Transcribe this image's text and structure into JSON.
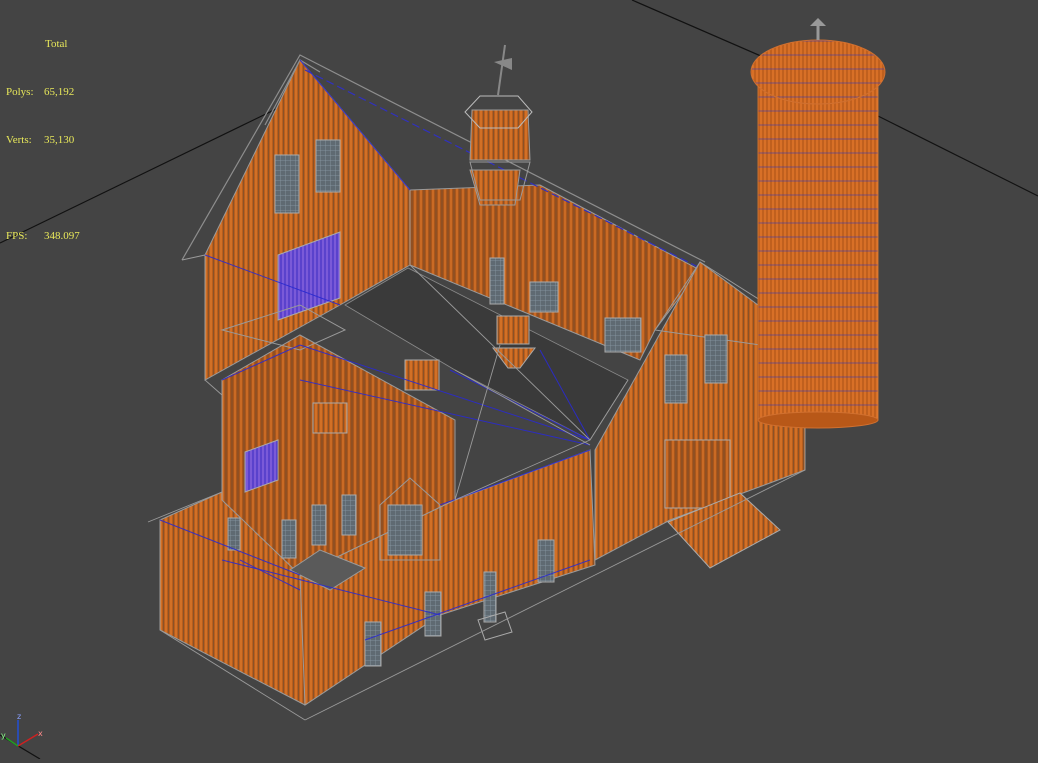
{
  "stats": {
    "title": "Total",
    "polys_label": "Polys:",
    "polys_value": "65,192",
    "verts_label": "Verts:",
    "verts_value": "35,130",
    "fps_label": "FPS:",
    "fps_value": "348.097"
  },
  "viewport": {
    "background": "#444444",
    "wire_color": "#c8651e",
    "edge_color": "#7a7a7a",
    "selection_color": "#2a2ad0",
    "axis_labels": {
      "x": "x",
      "y": "y",
      "z": "z"
    },
    "axis_colors": {
      "x": "#d02020",
      "y": "#20a020",
      "z": "#2050e0"
    }
  }
}
